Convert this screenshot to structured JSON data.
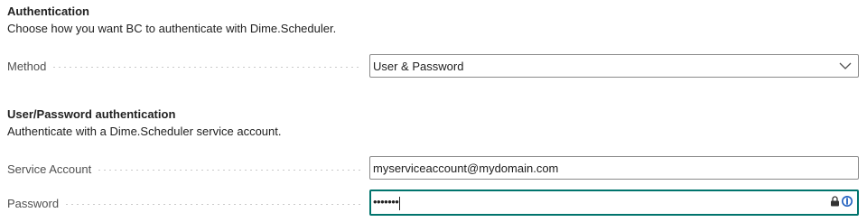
{
  "auth": {
    "title": "Authentication",
    "description": "Choose how you want BC to authenticate with Dime.Scheduler.",
    "method_label": "Method",
    "method_value": "User & Password"
  },
  "userpw": {
    "title": "User/Password authentication",
    "description": "Authenticate with a Dime.Scheduler service account.",
    "account_label": "Service Account",
    "account_value": "myserviceaccount@mydomain.com",
    "password_label": "Password",
    "password_value": "•••••••"
  },
  "icons": {
    "dropdown": "chevron-down-icon",
    "lock": "lock-icon",
    "password_manager": "password-manager-icon"
  },
  "colors": {
    "focus_border": "#00746d",
    "label_text": "#505050"
  }
}
